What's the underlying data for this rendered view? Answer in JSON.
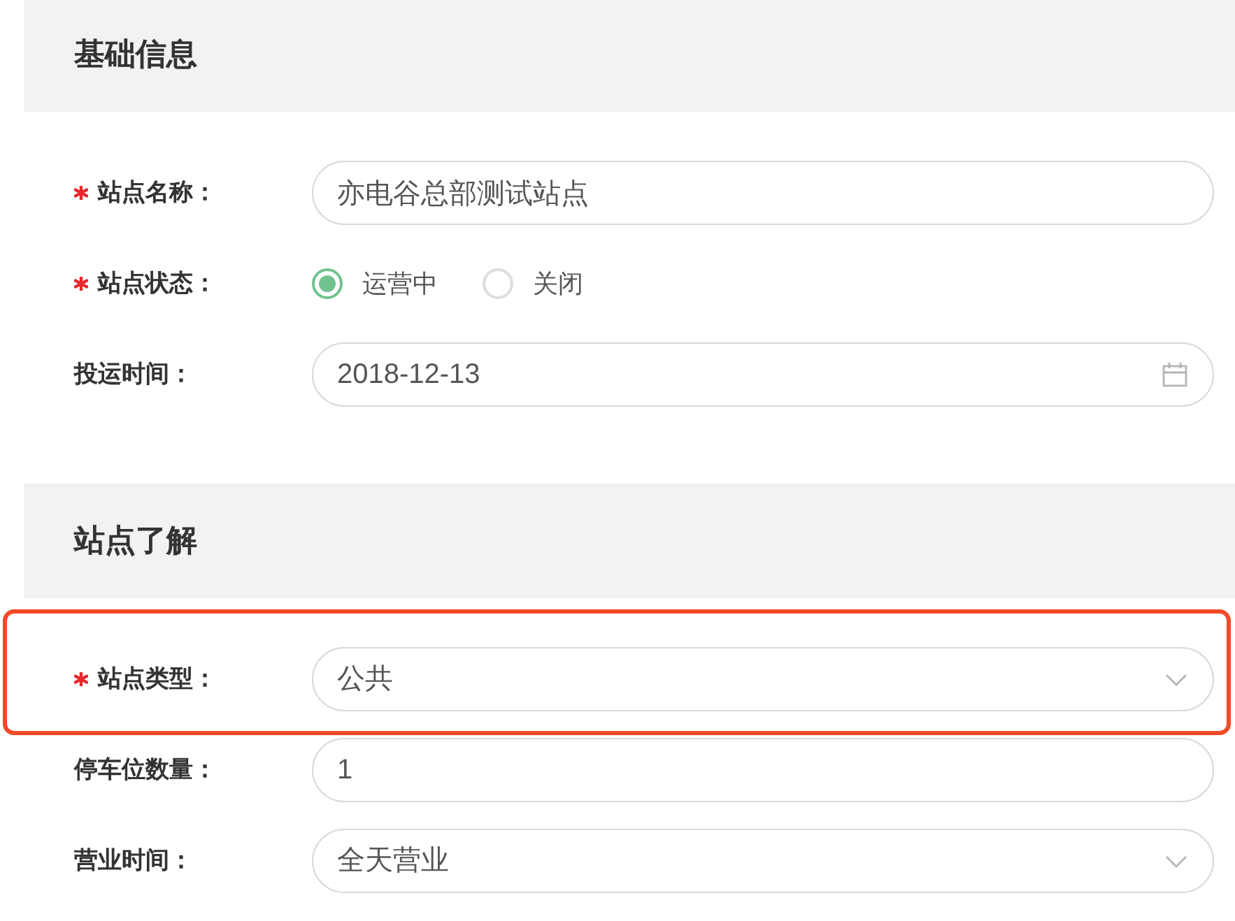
{
  "sections": [
    {
      "title": "基础信息",
      "fields": [
        {
          "kind": "text",
          "label": "站点名称：",
          "required": true,
          "highlighted": false,
          "value": "亦电谷总部测试站点"
        },
        {
          "kind": "radio",
          "label": "站点状态：",
          "required": true,
          "highlighted": false,
          "options": [
            {
              "label": "运营中",
              "selected": true
            },
            {
              "label": "关闭",
              "selected": false
            }
          ]
        },
        {
          "kind": "date",
          "label": "投运时间：",
          "required": false,
          "highlighted": false,
          "value": "2018-12-13"
        }
      ]
    },
    {
      "title": "站点了解",
      "fields": [
        {
          "kind": "select",
          "label": "站点类型：",
          "required": true,
          "highlighted": true,
          "value": "公共"
        },
        {
          "kind": "text",
          "label": "停车位数量：",
          "required": false,
          "highlighted": false,
          "value": "1"
        },
        {
          "kind": "select",
          "label": "营业时间：",
          "required": false,
          "highlighted": false,
          "value": "全天营业"
        }
      ]
    }
  ]
}
